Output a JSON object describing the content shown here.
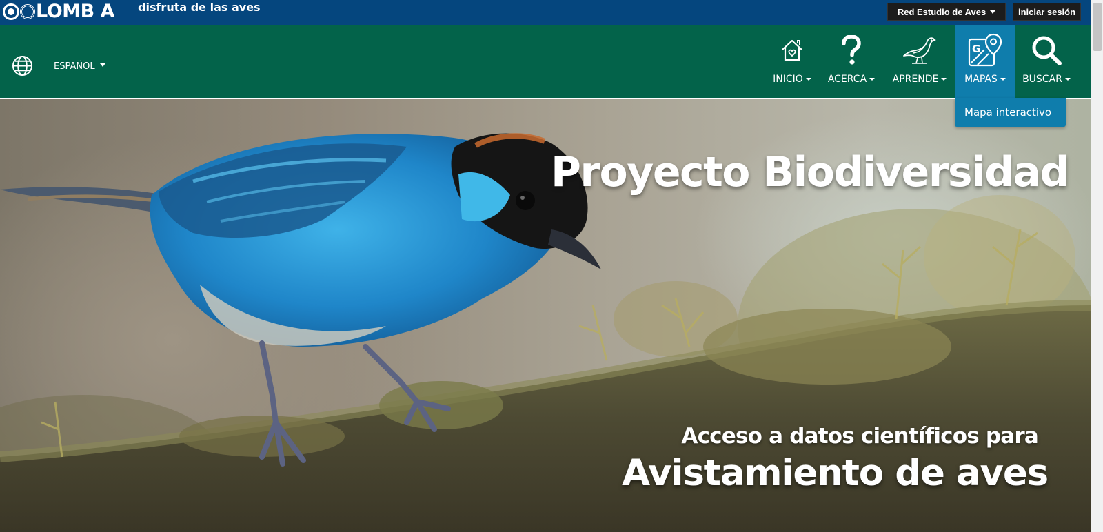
{
  "brand": {
    "logo_text": "LOMB A",
    "tagline": "disfruta de las aves"
  },
  "topbar": {
    "network_button": "Red Estudio de Aves",
    "login_button": "iniciar sesión"
  },
  "language": {
    "icon": "globe-icon",
    "selected": "ESPAÑOL"
  },
  "nav": {
    "inicio": {
      "label": "INICIO",
      "icon": "house-heart-icon"
    },
    "acerca": {
      "label": "ACERCA",
      "icon": "question-mark-icon"
    },
    "aprende": {
      "label": "APRENDE",
      "icon": "bird-icon"
    },
    "mapas": {
      "label": "MAPAS",
      "icon": "map-pin-icon"
    },
    "buscar": {
      "label": "BUSCAR",
      "icon": "search-icon"
    }
  },
  "dropdown": {
    "items": [
      "Mapa interactivo"
    ]
  },
  "hero": {
    "title": "Proyecto Biodiversidad",
    "subtitle": "Acceso a datos científicos para",
    "headline": "Avistamiento de aves"
  },
  "colors": {
    "topbar": "#05467e",
    "nav": "#03634a",
    "active_nav": "#0f7dac",
    "button_dark": "#1c1c1c"
  }
}
